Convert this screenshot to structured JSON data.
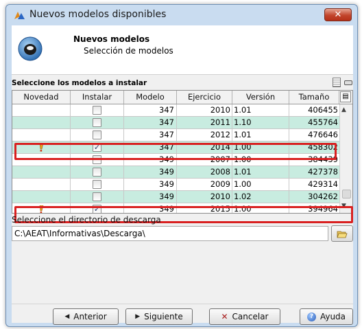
{
  "window": {
    "title": "Nuevos modelos disponibles",
    "close_label": "✕"
  },
  "header": {
    "title": "Nuevos modelos",
    "subtitle": "Selección de modelos"
  },
  "section_label": "Seleccione los modelos a instalar",
  "table": {
    "columns": [
      "Novedad",
      "Instalar",
      "Modelo",
      "Ejercicio",
      "Versión",
      "Tamaño"
    ],
    "rows": [
      {
        "novedad": false,
        "instalar": false,
        "modelo": "347",
        "ejercicio": "2010",
        "version": "1.01",
        "tamano": "406455"
      },
      {
        "novedad": false,
        "instalar": false,
        "modelo": "347",
        "ejercicio": "2011",
        "version": "1.10",
        "tamano": "455764"
      },
      {
        "novedad": false,
        "instalar": false,
        "modelo": "347",
        "ejercicio": "2012",
        "version": "1.01",
        "tamano": "476646"
      },
      {
        "novedad": true,
        "instalar": true,
        "modelo": "347",
        "ejercicio": "2014",
        "version": "1.00",
        "tamano": "458302"
      },
      {
        "novedad": false,
        "instalar": false,
        "modelo": "349",
        "ejercicio": "2007",
        "version": "1.00",
        "tamano": "384439"
      },
      {
        "novedad": false,
        "instalar": false,
        "modelo": "349",
        "ejercicio": "2008",
        "version": "1.01",
        "tamano": "427378"
      },
      {
        "novedad": false,
        "instalar": false,
        "modelo": "349",
        "ejercicio": "2009",
        "version": "1.00",
        "tamano": "429314"
      },
      {
        "novedad": false,
        "instalar": false,
        "modelo": "349",
        "ejercicio": "2010",
        "version": "1.02",
        "tamano": "304262"
      },
      {
        "novedad": true,
        "instalar": true,
        "modelo": "349",
        "ejercicio": "2015",
        "version": "1.00",
        "tamano": "394964"
      }
    ]
  },
  "directory": {
    "label": "Seleccione el directorio de descarga",
    "value": "C:\\AEAT\\Informativas\\Descarga\\"
  },
  "buttons": {
    "prev": "Anterior",
    "next": "Siguiente",
    "cancel": "Cancelar",
    "help": "Ayuda"
  },
  "icons": {
    "novedad": "warning-icon",
    "close": "close-icon",
    "browse": "folder-open-icon",
    "help": "help-icon"
  },
  "colors": {
    "row_alt": "#c8ece0",
    "highlight": "#d92020",
    "close_button": "#c2452c"
  }
}
